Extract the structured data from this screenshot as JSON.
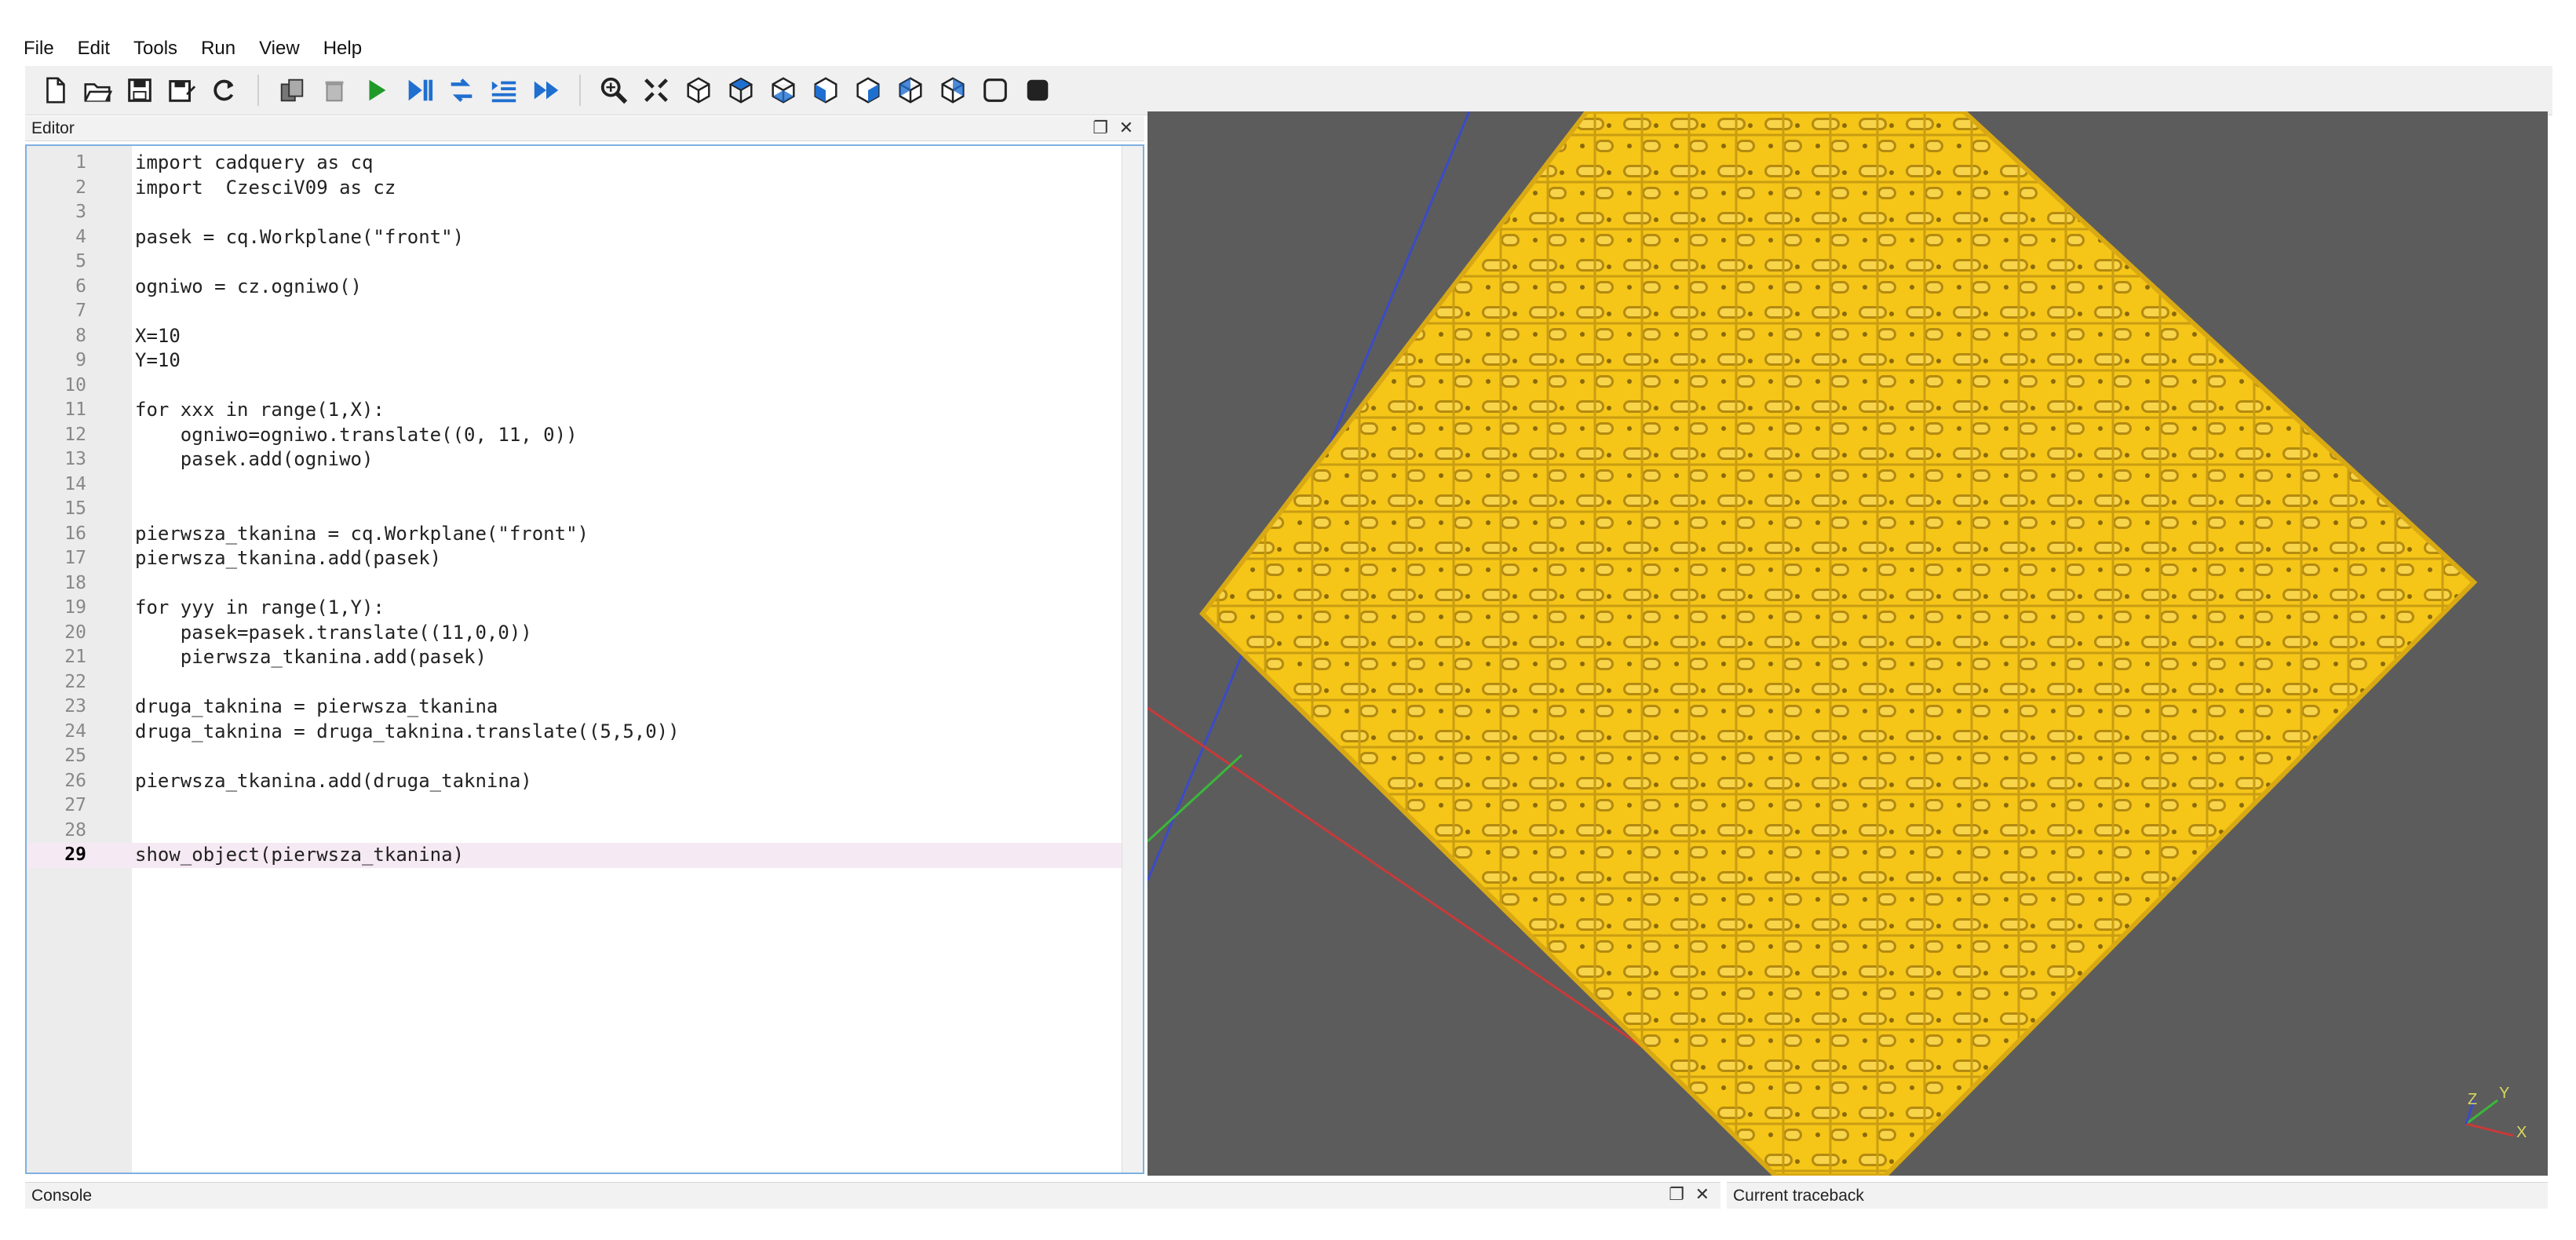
{
  "menu": [
    "File",
    "Edit",
    "Tools",
    "Run",
    "View",
    "Help"
  ],
  "toolbar_icons": [
    "new-file-icon",
    "open-file-icon",
    "save-icon",
    "save-as-icon",
    "reload-icon",
    "copy-icon",
    "delete-icon",
    "run-icon",
    "step-icon",
    "redo-icon",
    "indent-icon",
    "fast-forward-icon",
    "inspect-icon",
    "fit-view-icon",
    "iso-view-icon",
    "top-view-icon",
    "bottom-view-icon",
    "front-view-icon",
    "back-view-icon",
    "left-view-icon",
    "right-view-icon",
    "wireframe-icon",
    "shaded-icon"
  ],
  "editor": {
    "title": "Editor",
    "current_line": 29,
    "lines": [
      {
        "n": "1",
        "text": "import cadquery as cq"
      },
      {
        "n": "2",
        "text": "import  CzesciV09 as cz"
      },
      {
        "n": "3",
        "text": ""
      },
      {
        "n": "4",
        "text": "pasek = cq.Workplane(\"front\")"
      },
      {
        "n": "5",
        "text": ""
      },
      {
        "n": "6",
        "text": "ogniwo = cz.ogniwo()"
      },
      {
        "n": "7",
        "text": ""
      },
      {
        "n": "8",
        "text": "X=10"
      },
      {
        "n": "9",
        "text": "Y=10"
      },
      {
        "n": "10",
        "text": ""
      },
      {
        "n": "11",
        "text": "for xxx in range(1,X):"
      },
      {
        "n": "12",
        "text": "    ogniwo=ogniwo.translate((0, 11, 0))"
      },
      {
        "n": "13",
        "text": "    pasek.add(ogniwo)"
      },
      {
        "n": "14",
        "text": ""
      },
      {
        "n": "15",
        "text": ""
      },
      {
        "n": "16",
        "text": "pierwsza_tkanina = cq.Workplane(\"front\")"
      },
      {
        "n": "17",
        "text": "pierwsza_tkanina.add(pasek)"
      },
      {
        "n": "18",
        "text": ""
      },
      {
        "n": "19",
        "text": "for yyy in range(1,Y):"
      },
      {
        "n": "20",
        "text": "    pasek=pasek.translate((11,0,0))"
      },
      {
        "n": "21",
        "text": "    pierwsza_tkanina.add(pasek)"
      },
      {
        "n": "22",
        "text": ""
      },
      {
        "n": "23",
        "text": "druga_taknina = pierwsza_tkanina"
      },
      {
        "n": "24",
        "text": "druga_taknina = druga_taknina.translate((5,5,0))"
      },
      {
        "n": "25",
        "text": ""
      },
      {
        "n": "26",
        "text": "pierwsza_tkanina.add(druga_taknina)"
      },
      {
        "n": "27",
        "text": ""
      },
      {
        "n": "28",
        "text": ""
      },
      {
        "n": "29",
        "text": "show_object(pierwsza_tkanina)"
      }
    ]
  },
  "console": {
    "title": "Console"
  },
  "traceback": {
    "title": "Current traceback"
  },
  "axes": {
    "x": "X",
    "y": "Y",
    "z": "Z"
  },
  "colors": {
    "model": "#f5c518",
    "viewer_bg": "#5c5c5c",
    "accent": "#7fb0e0"
  }
}
